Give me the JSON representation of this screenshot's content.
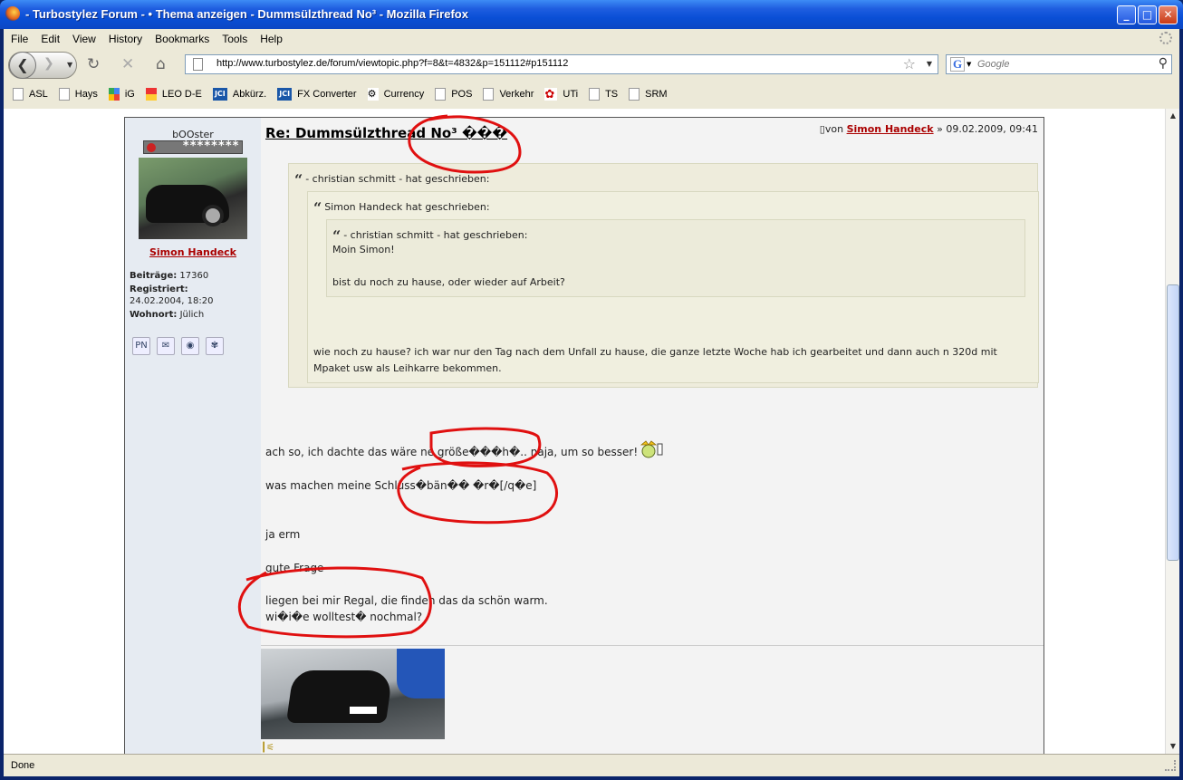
{
  "window": {
    "title": "- Turbostylez Forum - • Thema anzeigen - Dummsülzthread No³ - Mozilla Firefox",
    "buttons": {
      "minimize": "_",
      "maximize": "□",
      "close": "✕"
    }
  },
  "menu": [
    "File",
    "Edit",
    "View",
    "History",
    "Bookmarks",
    "Tools",
    "Help"
  ],
  "nav": {
    "url": "http://www.turbostylez.de/forum/viewtopic.php?f=8&t=4832&p=151112#p151112",
    "search_placeholder": "Google"
  },
  "bookmarks": [
    {
      "label": "ASL",
      "icon": "page-icon"
    },
    {
      "label": "Hays",
      "icon": "page-icon"
    },
    {
      "label": "iG",
      "icon": "google-icon"
    },
    {
      "label": "LEO D-E",
      "icon": "leo-icon"
    },
    {
      "label": "Abkürz.",
      "icon": "jci-icon"
    },
    {
      "label": "FX Converter",
      "icon": "jci-icon"
    },
    {
      "label": "Currency",
      "icon": "currency-icon"
    },
    {
      "label": "POS",
      "icon": "page-icon"
    },
    {
      "label": "Verkehr",
      "icon": "page-icon"
    },
    {
      "label": "UTi",
      "icon": "uti-icon"
    },
    {
      "label": "TS",
      "icon": "page-icon"
    },
    {
      "label": "SRM",
      "icon": "page-icon"
    }
  ],
  "profile": {
    "username": "bOOster",
    "rank": "********",
    "link": "Simon Handeck",
    "posts_label": "Beiträge:",
    "posts": "17360",
    "registered_label": "Registriert:",
    "registered": "24.02.2004, 18:20",
    "location_label": "Wohnort:",
    "location": "Jülich"
  },
  "post": {
    "title": "Re: Dummsülzthread No³ ���",
    "meta_prefix": "von",
    "author": "Simon Handeck",
    "date": "» 09.02.2009, 09:41",
    "quote1_header": "- christian schmitt - hat geschrieben:",
    "quote2_header": "Simon Handeck hat geschrieben:",
    "quote3_header": "- christian schmitt - hat geschrieben:",
    "quote3_line1": "Moin Simon!",
    "quote3_line2": "bist du noch zu hause, oder wieder auf Arbeit?",
    "quote2_line1": "wie noch zu hause? ich war nur den Tag nach dem Unfall zu hause, die ganze letzte Woche hab ich gearbeitet und dann auch n 320d mit",
    "quote2_line2": "Mpaket usw als Leihkarre bekommen.",
    "body_line1": "ach so, ich dachte das wäre ne größe���h�.. naja, um so besser!",
    "body_line2": "was machen meine Schlüss�bän�� �r�[/q�e]",
    "body_line3": "ja erm",
    "body_line4": "gute Frage",
    "body_line5": "liegen bei mir Regal, die finden das da schön warm.",
    "body_line6": "wi�i�e wolltest� nochmal?"
  },
  "status": "Done"
}
